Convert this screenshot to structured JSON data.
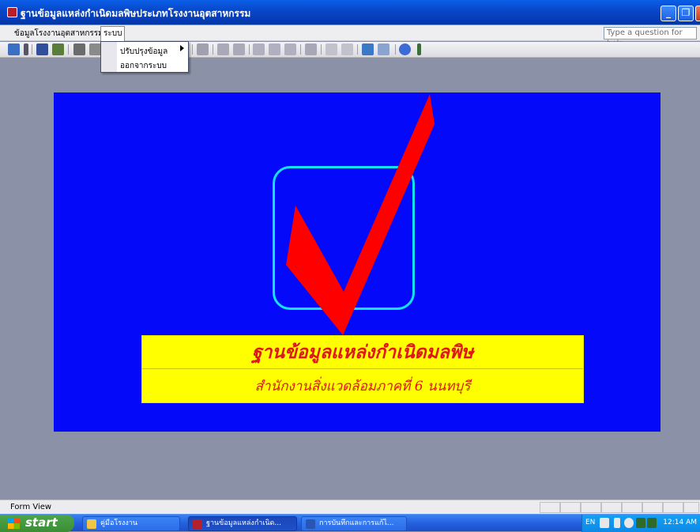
{
  "window": {
    "title": "ฐานข้อมูลแหล่งกำเนิดมลพิษประเภทโรงงานอุตสาหกรรม"
  },
  "menubar": {
    "items": [
      "ข้อมูลโรงงานอุตสาหกรรม",
      "ระบบ"
    ],
    "help_placeholder": "Type a question for help"
  },
  "dropdown": {
    "items": [
      "ปรับปรุงข้อมูล",
      "ออกจากระบบ"
    ]
  },
  "form": {
    "title": "ฐานข้อมูลแหล่งกำเนิดมลพิษ",
    "subtitle": "สำนักงานสิ่งแวดล้อมภาคที่ 6 นนทบุรี"
  },
  "statusbar": {
    "text": "Form View"
  },
  "taskbar": {
    "start_label": "start",
    "tasks": [
      "คู่มือโรงงาน",
      "ฐานข้อมูลแหล่งกำเนิด...",
      "การบันทึกและการแก้ไ..."
    ],
    "language": "EN",
    "clock": "12:14 AM"
  },
  "colors": {
    "canvas": "#0509f9",
    "banner": "#ffff00",
    "banner_text": "#e01717",
    "checkmark": "#ff0000",
    "box_border": "#13e1f5"
  }
}
